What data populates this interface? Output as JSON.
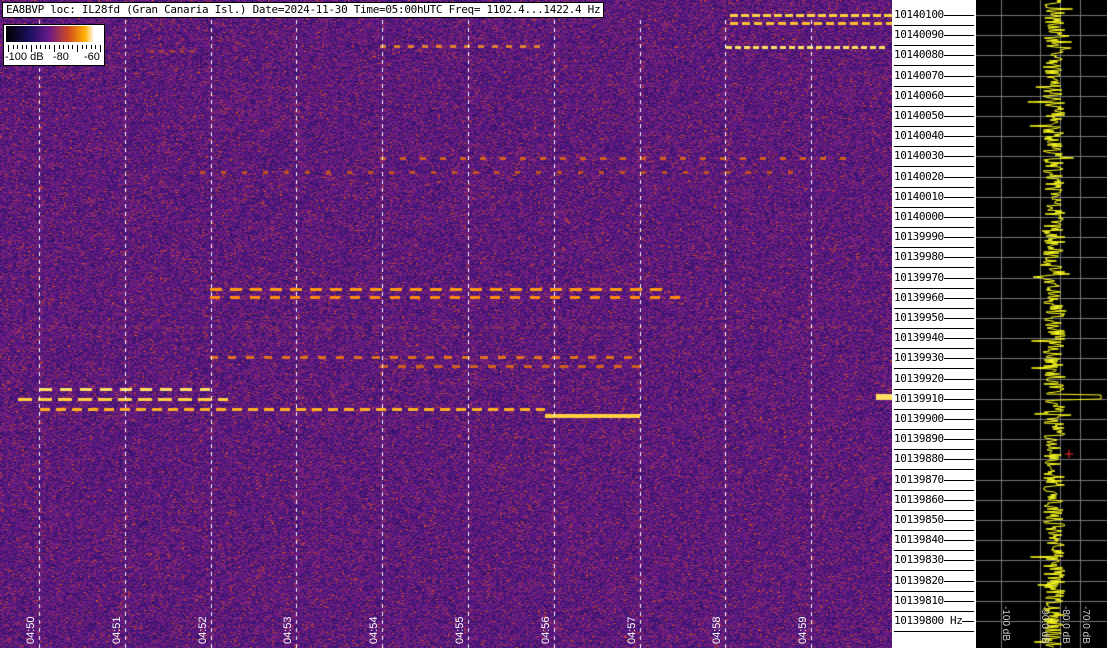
{
  "title": "EA8BVP loc: IL28fd (Gran Canaria Isl.) Date=2024-11-30 Time=05:00hUTC Freq= 1102.4...1422.4 Hz",
  "colorbar": {
    "labels": [
      "-100 dB",
      "-80",
      "-60"
    ],
    "min_db": -100,
    "max_db": -60
  },
  "chart_data": {
    "type": "heatmap",
    "title": "EA8BVP loc: IL28fd (Gran Canaria Isl.) Date=2024-11-30 Time=05:00hUTC Freq= 1102.4...1422.4 Hz",
    "x_ticks": [
      "04:50",
      "04:51",
      "04:52",
      "04:53",
      "04:54",
      "04:55",
      "04:56",
      "04:57",
      "04:58",
      "04:59"
    ],
    "y_ticks": [
      "10140100",
      "10140090",
      "10140080",
      "10140070",
      "10140060",
      "10140050",
      "10140040",
      "10140030",
      "10140020",
      "10140010",
      "10140000",
      "10139990",
      "10139980",
      "10139970",
      "10139960",
      "10139950",
      "10139940",
      "10139930",
      "10139920",
      "10139910",
      "10139900",
      "10139890",
      "10139880",
      "10139870",
      "10139860",
      "10139850",
      "10139840",
      "10139830",
      "10139820",
      "10139810",
      "10139800 Hz"
    ],
    "y_unit": "Hz",
    "grid": true,
    "spectrum_panel": {
      "x_ticks": [
        "-100 dB",
        "-90.0 dB",
        "-80.0 dB",
        "-70.0 dB"
      ]
    }
  }
}
